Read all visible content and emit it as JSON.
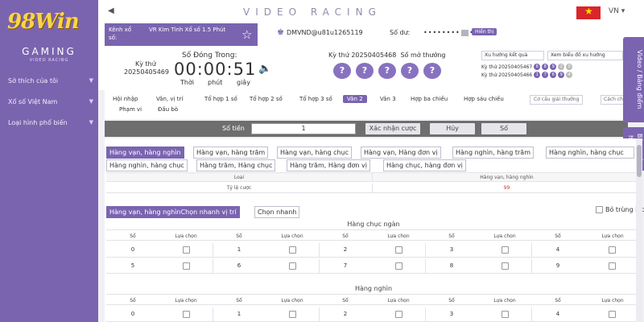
{
  "brand": {
    "logo": "98Win",
    "gaming": "GAMING",
    "sub": "VIDEO RACING"
  },
  "sidebar": {
    "items": [
      {
        "label": "Sở thích của tôi"
      },
      {
        "label": "Xổ số Việt Nam"
      },
      {
        "label": "Loại hình phổ biến"
      }
    ]
  },
  "header": {
    "title": "VIDEO RACING",
    "lang": "VN",
    "flag_color": "#da251d"
  },
  "channel": {
    "label": "Kênh xổ số:",
    "name": "VR Kim Tinh Xổ số 1.5 Phút"
  },
  "user": {
    "name": "DMVND@u81u1265119",
    "balance_label": "Số dư:",
    "balance": "•••••••••••",
    "show_label": "Hiển thị"
  },
  "draw": {
    "current_label": "Kỳ thứ",
    "current_number": "20250405469",
    "countdown_label": "Số Đóng Trong:",
    "countdown": "00:00:51",
    "time_labels": [
      "Thời",
      "phút",
      "giây"
    ],
    "next_label": "Kỳ thứ 20250405468",
    "result_label": "Số mở thưởng",
    "balls": [
      "?",
      "?",
      "?",
      "?",
      "?"
    ]
  },
  "trend": {
    "buttons": [
      "Xu hướng kết quả",
      "Xem biểu đồ xu hướng"
    ],
    "history": [
      {
        "label": "Kỳ thứ 20250405467",
        "balls": [
          "6",
          "8",
          "9",
          "2",
          "0"
        ]
      },
      {
        "label": "Kỳ thứ 20250405466",
        "balls": [
          "1",
          "7",
          "6",
          "9",
          "4"
        ]
      }
    ]
  },
  "modes": {
    "row1": [
      "Hội nhập",
      "Vân, vị trí",
      "Tổ hợp 1 số",
      "Tổ hợp 2 số",
      "Tổ hợp 3 số",
      "Vân 2",
      "Vân 3",
      "Hợp ba chiều",
      "Hợp sáu chiều"
    ],
    "row2": [
      "Phạm vi",
      "Đấu bò"
    ],
    "active": "Vân 2",
    "cocau": "Cơ cấu giải thưởng",
    "cach": "Cách chơi"
  },
  "bet": {
    "label": "Số tiền",
    "value": "1",
    "confirm": "Xác nhận cược",
    "cancel": "Hủy",
    "number": "Số"
  },
  "side_tabs": [
    "Video / Bảng điểm",
    "Bảng xếp hạng dài"
  ],
  "bet_tabs": [
    "Hàng vạn, hàng nghìn",
    "Hàng vạn, hàng trăm",
    "Hàng vạn, hàng chục",
    "Hàng vạn, Hàng đơn vị",
    "Hàng nghìn, hàng trăm",
    "Hàng nghìn, hàng chục",
    "Hàng nghìn, hàng chục",
    "Hàng trăm, Hàng chục",
    "Hàng trăm, Hàng đơn vị",
    "Hàng chục, hàng đơn vị"
  ],
  "odds": {
    "col1": "Loại",
    "col2": "Hàng vạn, hàng nghìn",
    "row_label": "Tỷ lệ cược",
    "row_value": "99"
  },
  "sub_tabs": [
    "Hàng vạn, hàng nghìnChọn nhanh vị trí",
    "Chọn nhanh"
  ],
  "bo_trung": "Bỏ trùng lặp",
  "section1": {
    "title": "Hàng chục ngàn",
    "head_num": "Số",
    "head_pick": "Lựa chọn",
    "rows": [
      [
        "0",
        "1",
        "2",
        "3",
        "4"
      ],
      [
        "5",
        "6",
        "7",
        "8",
        "9"
      ]
    ]
  },
  "section2": {
    "title": "Hàng nghìn",
    "head_num": "Số",
    "head_pick": "Lựa chọn",
    "rows": [
      [
        "0",
        "1",
        "2",
        "3",
        "4"
      ]
    ]
  }
}
